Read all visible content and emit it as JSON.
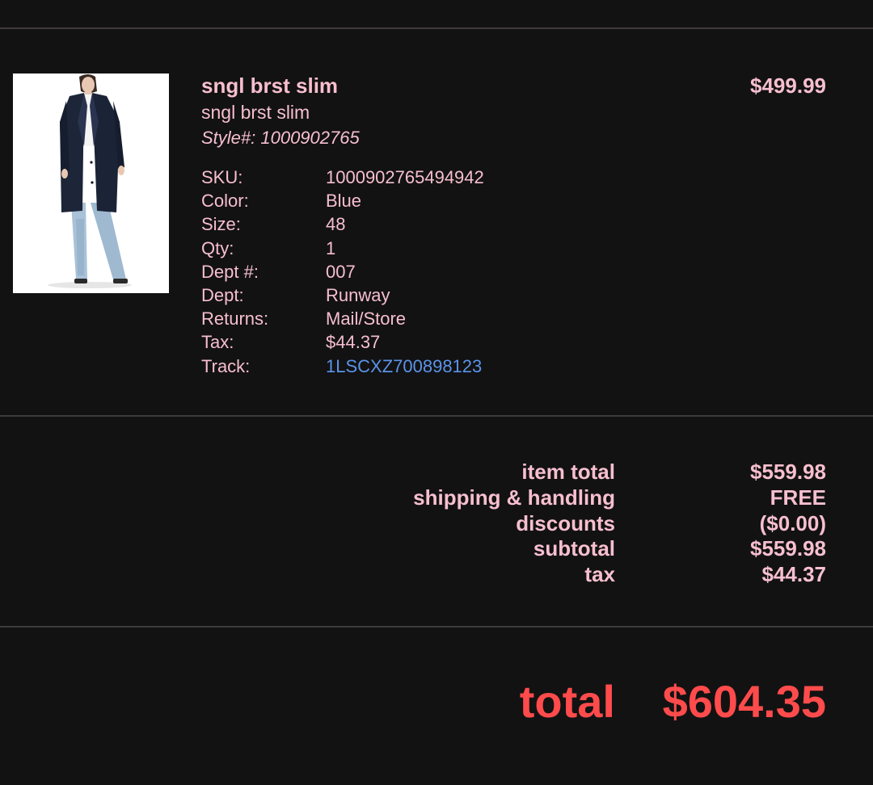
{
  "item": {
    "image_alt": "coat-photo",
    "name": "sngl brst slim",
    "subname": "sngl brst slim",
    "style": "Style#: 1000902765",
    "price": "$499.99",
    "details": [
      {
        "label": "SKU:",
        "value": "1000902765494942"
      },
      {
        "label": "Color:",
        "value": "Blue"
      },
      {
        "label": "Size:",
        "value": "48"
      },
      {
        "label": "Qty:",
        "value": "1"
      },
      {
        "label": "Dept #:",
        "value": "007"
      },
      {
        "label": "Dept:",
        "value": "Runway"
      },
      {
        "label": "Returns:",
        "value": "Mail/Store"
      },
      {
        "label": "Tax:",
        "value": "$44.37"
      },
      {
        "label": "Track:",
        "value": "1LSCXZ700898123"
      }
    ]
  },
  "summary": {
    "rows": [
      {
        "label": "item total",
        "value": "$559.98"
      },
      {
        "label": "shipping & handling",
        "value": "FREE"
      },
      {
        "label": "discounts",
        "value": "($0.00)"
      },
      {
        "label": "subtotal",
        "value": "$559.98"
      },
      {
        "label": "tax",
        "value": "$44.37"
      }
    ],
    "total_label": "total",
    "total_value": "$604.35"
  },
  "colors": {
    "background": "#121212",
    "text_pink": "#f7bfd0",
    "link_blue": "#5b93e8",
    "total_red": "#ff4b4b",
    "divider": "#3f3a3b"
  }
}
